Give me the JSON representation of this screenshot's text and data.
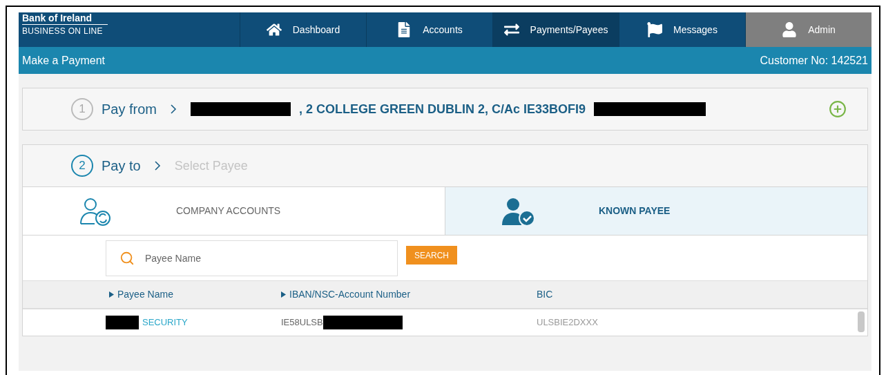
{
  "brand": {
    "name": "Bank of Ireland",
    "tagline": "BUSINESS ON LINE"
  },
  "nav": [
    {
      "label": "Dashboard",
      "kind": "link",
      "selected": false
    },
    {
      "label": "Accounts",
      "kind": "link",
      "selected": false
    },
    {
      "label": "Payments/Payees",
      "kind": "link",
      "selected": true
    },
    {
      "label": "Messages",
      "kind": "link",
      "selected": false
    },
    {
      "label": "Admin",
      "kind": "account",
      "selected": false
    }
  ],
  "page_title": "Make a Payment",
  "customer": "Customer No: 142521",
  "steps": [
    {
      "number": "1",
      "label": "Pay from",
      "value": ", 2 COLLEGE GREEN DUBLIN 2, C/Ac IE33BOFI9",
      "active": false
    },
    {
      "number": "2",
      "label": "Pay to",
      "prompt": "Select Payee",
      "active": true
    }
  ],
  "payee_tabs": [
    {
      "label": "COMPANY ACCOUNTS",
      "selected": false
    },
    {
      "label": "KNOWN PAYEE",
      "selected": true
    }
  ],
  "search": {
    "placeholder": "Payee Name",
    "button": "SEARCH"
  },
  "table": {
    "columns": [
      {
        "label": "Payee Name",
        "sortable": true
      },
      {
        "label": "IBAN/NSC-Account Number",
        "sortable": true
      },
      {
        "label": "BIC",
        "sortable": false
      }
    ],
    "rows": [
      {
        "payee": "SECURITY",
        "iban": "IE58ULSB",
        "bic": "ULSBIE2DXXX"
      }
    ]
  }
}
